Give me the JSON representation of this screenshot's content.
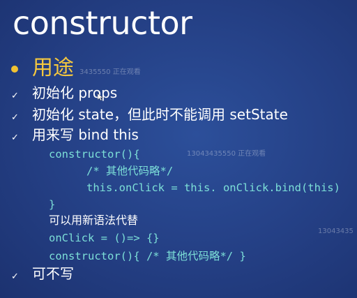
{
  "slide": {
    "title": "constructor",
    "heading": "用途",
    "check_glyph": "✓",
    "items": [
      "初始化 props",
      "初始化 state，但此时不能调用 setState",
      "用来写 bind this"
    ],
    "code_block": [
      "constructor(){",
      "/* 其他代码略*/",
      "this.onClick = this. onClick.bind(this)",
      "}"
    ],
    "note": "可以用新语法代替",
    "code_alt": [
      "onClick = ()=> {}",
      "constructor(){ /* 其他代码略*/ }"
    ],
    "last_item": "可不写"
  },
  "watermarks": [
    "3435550 正在观看",
    "13043435550 正在观看",
    "13043435"
  ],
  "colors": {
    "background": "#243f84",
    "heading": "#f4c73f",
    "bullet": "#f1c232",
    "code": "#7de0d8",
    "text": "#ffffff"
  }
}
